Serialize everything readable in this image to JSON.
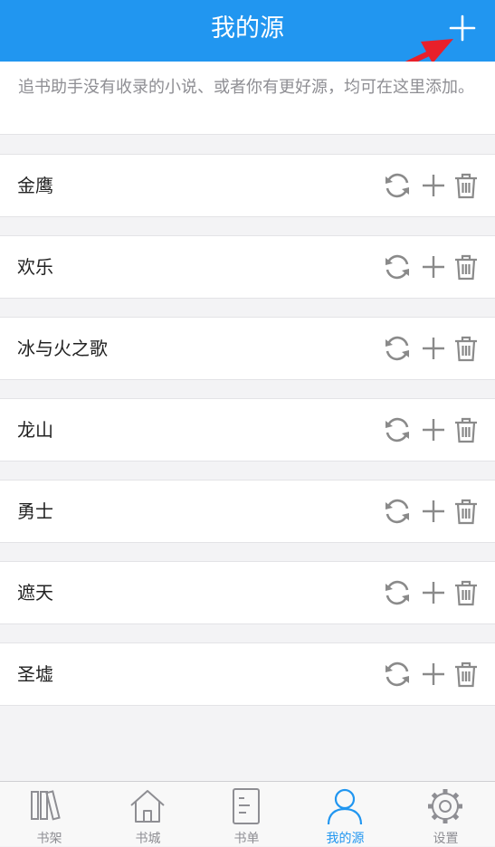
{
  "header": {
    "title": "我的源"
  },
  "description": "追书助手没有收录的小说、或者你有更好源，均可在这里添加。",
  "sources": [
    {
      "name": "金鹰"
    },
    {
      "name": "欢乐"
    },
    {
      "name": "冰与火之歌"
    },
    {
      "name": "龙山"
    },
    {
      "name": "勇士"
    },
    {
      "name": "遮天"
    },
    {
      "name": "圣墟"
    }
  ],
  "tabs": [
    {
      "label": "书架",
      "icon": "bookshelf-icon"
    },
    {
      "label": "书城",
      "icon": "home-icon"
    },
    {
      "label": "书单",
      "icon": "booklist-icon"
    },
    {
      "label": "我的源",
      "icon": "user-icon",
      "active": true
    },
    {
      "label": "设置",
      "icon": "gear-icon"
    }
  ],
  "colors": {
    "primary": "#2196f0",
    "annotation_arrow": "#e8202a",
    "icon_gray": "#8a8a8a",
    "tab_inactive": "#8e8e93"
  }
}
